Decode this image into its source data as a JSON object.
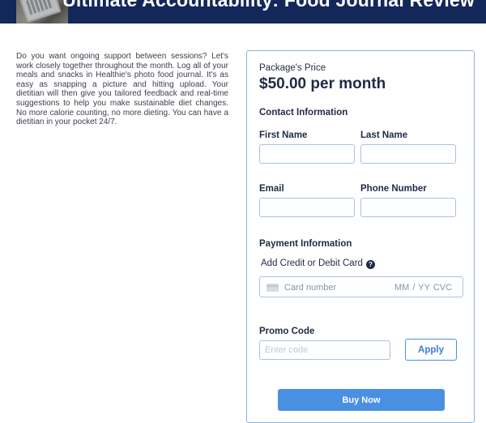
{
  "header": {
    "title": "Ultimate Accountability: Food Journal Review",
    "image": "laptop-photo"
  },
  "intro": {
    "text": "Do you want ongoing support between sessions? Let's work closely together throughout the month. Log all of your meals and snacks in Healthie's photo food journal. It's as easy as snapping a picture and hitting upload. Your dietitian will then give you tailored feedback and real-time suggestions to help you make sustainable diet changes. No more calorie counting, no more dieting. You can have a dietitian in your pocket 24/7."
  },
  "form": {
    "price_label": "Package's Price",
    "price_value": "$50.00 per month",
    "contact_heading": "Contact Information",
    "first_name_label": "First Name",
    "first_name_value": "",
    "last_name_label": "Last Name",
    "last_name_value": "",
    "email_label": "Email",
    "email_value": "",
    "phone_label": "Phone Number",
    "phone_value": "",
    "payment_heading": "Payment Information",
    "card_label": "Add Credit or Debit Card",
    "card_help_icon": "question-circle-icon",
    "card_number_placeholder": "Card number",
    "card_expiry_cvc_placeholder": "MM / YY  CVC",
    "promo_label": "Promo Code",
    "promo_placeholder": "Enter code",
    "apply_label": "Apply",
    "buy_label": "Buy Now"
  },
  "colors": {
    "banner": "#13275a",
    "accent": "#4a90e2",
    "card_border": "#8fb1d8",
    "text": "#1f2a44"
  }
}
